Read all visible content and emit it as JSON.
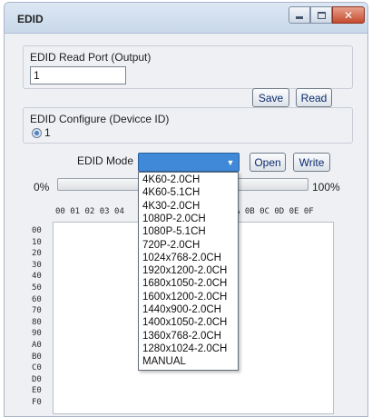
{
  "window": {
    "title": "EDID"
  },
  "read_port": {
    "label": "EDID Read Port (Output)",
    "value": "1"
  },
  "buttons": {
    "save": "Save",
    "read": "Read",
    "open": "Open",
    "write": "Write"
  },
  "configure": {
    "label": "EDID Configure (Devicce ID)",
    "device_id": "1"
  },
  "edid_mode": {
    "label": "EDID Mode",
    "selected": "",
    "options": [
      "4K60-2.0CH",
      "4K60-5.1CH",
      "4K30-2.0CH",
      "1080P-2.0CH",
      "1080P-5.1CH",
      "720P-2.0CH",
      "1024x768-2.0CH",
      "1920x1200-2.0CH",
      "1680x1050-2.0CH",
      "1600x1200-2.0CH",
      "1440x900-2.0CH",
      "1400x1050-2.0CH",
      "1360x768-2.0CH",
      "1280x1024-2.0CH",
      "MANUAL"
    ]
  },
  "progress": {
    "min_label": "0%",
    "max_label": "100%",
    "value": 0
  },
  "hex_view": {
    "header_left": "00 01 02 03 04",
    "header_right": "A 0B 0C 0D 0E 0F",
    "rows": [
      "00",
      "10",
      "20",
      "30",
      "40",
      "50",
      "60",
      "70",
      "80",
      "90",
      "A0",
      "B0",
      "C0",
      "D0",
      "E0",
      "F0"
    ]
  },
  "colors": {
    "combo_selected": "#3f89d8",
    "close_button": "#c54a2f",
    "titlebar": "#c9d8ea"
  },
  "icons": {
    "minimize": "minimize-icon",
    "maximize": "maximize-icon",
    "close": "close-icon",
    "dropdown": "chevron-down-icon"
  }
}
